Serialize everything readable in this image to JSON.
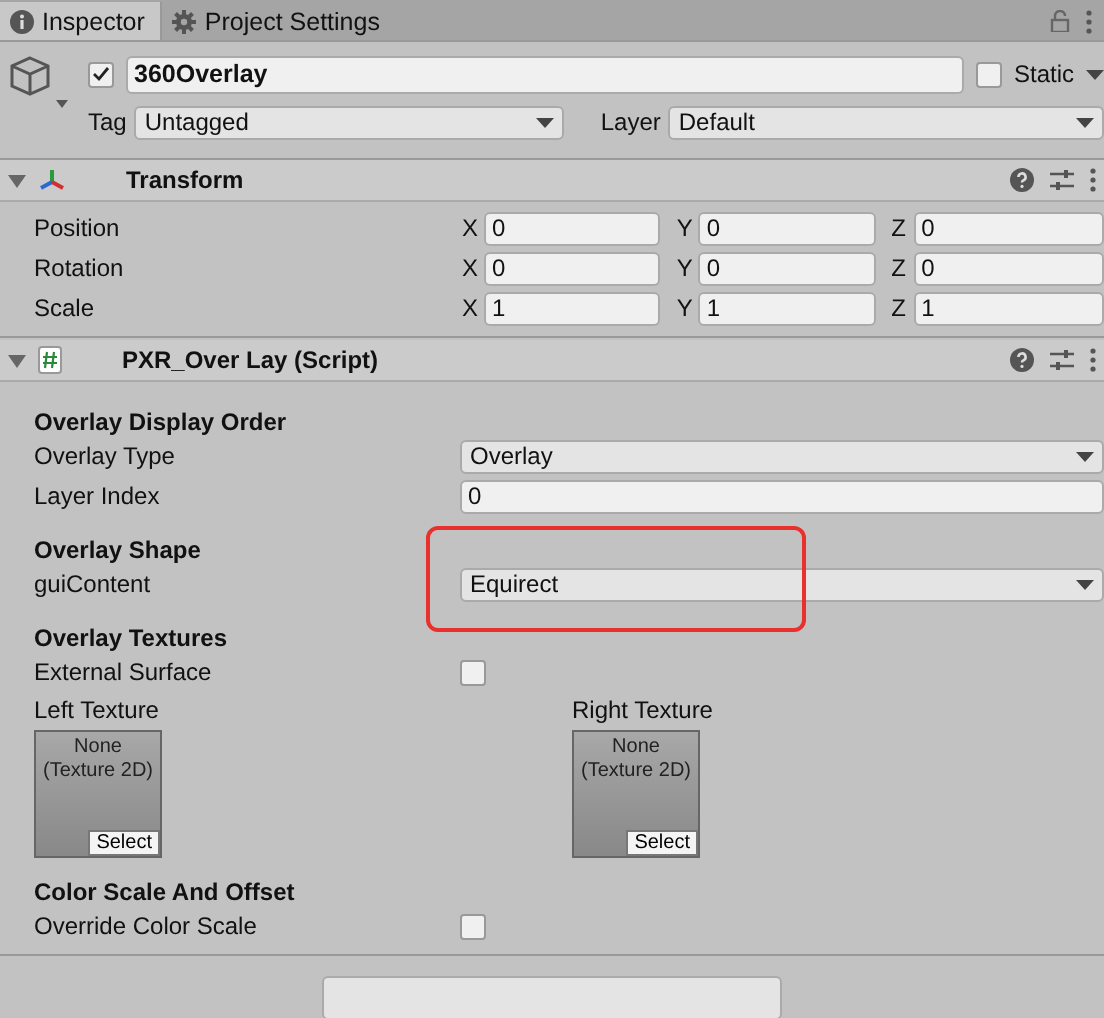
{
  "tabs": [
    {
      "label": "Inspector",
      "selected": true,
      "kind": "info"
    },
    {
      "label": "Project Settings",
      "selected": false,
      "kind": "gear"
    }
  ],
  "object": {
    "active": true,
    "name": "360Overlay",
    "static": false,
    "static_label": "Static",
    "tag_label": "Tag",
    "tag": "Untagged",
    "layer_label": "Layer",
    "layer": "Default"
  },
  "components": [
    {
      "title": "Transform",
      "expanded": true,
      "kind": "transform",
      "rows": [
        {
          "kind": "vector",
          "label": "Position",
          "fields": [
            {
              "axis": "X",
              "value": "0"
            },
            {
              "axis": "Y",
              "value": "0"
            },
            {
              "axis": "Z",
              "value": "0"
            }
          ]
        },
        {
          "kind": "vector",
          "label": "Rotation",
          "fields": [
            {
              "axis": "X",
              "value": "0"
            },
            {
              "axis": "Y",
              "value": "0"
            },
            {
              "axis": "Z",
              "value": "0"
            }
          ]
        },
        {
          "kind": "vector",
          "label": "Scale",
          "fields": [
            {
              "axis": "X",
              "value": "1"
            },
            {
              "axis": "Y",
              "value": "1"
            },
            {
              "axis": "Z",
              "value": "1"
            }
          ]
        }
      ]
    },
    {
      "title": "PXR_Over Lay (Script)",
      "expanded": true,
      "kind": "script",
      "rows": [
        {
          "kind": "header",
          "label": "Overlay Display Order"
        },
        {
          "kind": "dropdown",
          "label": "Overlay Type",
          "value": "Overlay",
          "highlighted": false
        },
        {
          "kind": "number",
          "label": "Layer Index",
          "value": "0"
        },
        {
          "kind": "header",
          "label": "Overlay Shape"
        },
        {
          "kind": "dropdown",
          "label": "guiContent",
          "value": "Equirect",
          "highlighted": true
        },
        {
          "kind": "header",
          "label": "Overlay Textures"
        },
        {
          "kind": "checkbox",
          "label": "External Surface",
          "checked": false
        },
        {
          "kind": "textures",
          "slots": [
            {
              "label": "Left Texture",
              "value": "None\n(Texture 2D)",
              "button": "Select"
            },
            {
              "label": "Right Texture",
              "value": "None\n(Texture 2D)",
              "button": "Select"
            }
          ]
        },
        {
          "kind": "header",
          "label": "Color Scale And Offset"
        },
        {
          "kind": "checkbox",
          "label": "Override Color Scale",
          "checked": false
        }
      ]
    }
  ]
}
